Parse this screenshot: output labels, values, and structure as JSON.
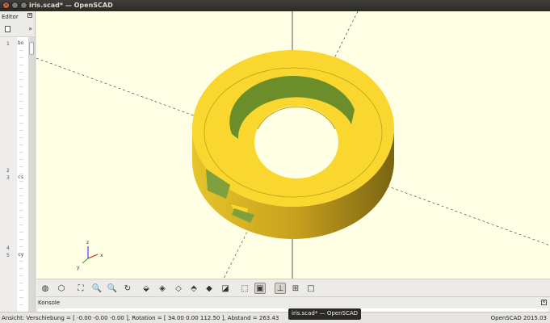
{
  "window": {
    "title": "iris.scad* — OpenSCAD"
  },
  "editor": {
    "title": "Editor",
    "more_label": "»",
    "line_numbers": [
      "1",
      "2",
      "3",
      "4",
      "5"
    ],
    "code_fragments": [
      "bo",
      "cs",
      "cy"
    ]
  },
  "viewport": {
    "background": "#ffffe5",
    "model_color": "#f9d72f",
    "model_shadow": "#e0a91a",
    "inner_color": "#7fa03c",
    "axes_labels": {
      "x": "x",
      "y": "y",
      "z": "z"
    }
  },
  "view_toolbar": {
    "buttons": [
      {
        "name": "preview-icon",
        "glyph": "◍"
      },
      {
        "name": "render-icon",
        "glyph": "⬡"
      },
      {
        "name": "view-all-icon",
        "glyph": "⛶"
      },
      {
        "name": "zoom-in-icon",
        "glyph": "🔍"
      },
      {
        "name": "zoom-out-icon",
        "glyph": "🔍"
      },
      {
        "name": "reset-view-icon",
        "glyph": "↻"
      },
      {
        "name": "view-right-icon",
        "glyph": "⬙"
      },
      {
        "name": "view-top-icon",
        "glyph": "◈"
      },
      {
        "name": "view-bottom-icon",
        "glyph": "◇"
      },
      {
        "name": "view-left-icon",
        "glyph": "⬘"
      },
      {
        "name": "view-front-icon",
        "glyph": "◆"
      },
      {
        "name": "view-back-icon",
        "glyph": "◪"
      },
      {
        "name": "perspective-icon",
        "glyph": "⬚"
      },
      {
        "name": "orthogonal-icon",
        "glyph": "▣"
      },
      {
        "name": "show-axes-icon",
        "glyph": "⊥"
      },
      {
        "name": "show-scale-icon",
        "glyph": "⊞"
      },
      {
        "name": "show-edges-icon",
        "glyph": "□"
      }
    ]
  },
  "console": {
    "title": "Konsole"
  },
  "status": {
    "left": "Ansicht: Verschiebung = [ -0.00 -0.00 -0.00 ], Rotation = [ 34.00 0.00 112.50 ], Abstand = 263.43",
    "right": "OpenSCAD 2015.03"
  },
  "tooltip": {
    "text": "iris.scad* — OpenSCAD"
  }
}
